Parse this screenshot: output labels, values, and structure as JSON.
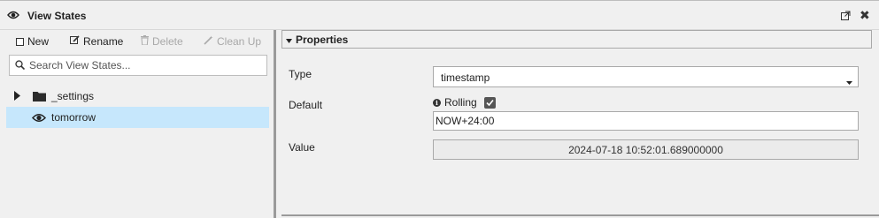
{
  "window": {
    "title": "View States"
  },
  "toolbar": {
    "new_label": "New",
    "rename_label": "Rename",
    "delete_label": "Delete",
    "cleanup_label": "Clean Up"
  },
  "search": {
    "placeholder": "Search View States..."
  },
  "tree": {
    "items": [
      {
        "label": "_settings",
        "type": "folder",
        "selected": false
      },
      {
        "label": "tomorrow",
        "type": "view-state",
        "selected": true
      }
    ]
  },
  "properties": {
    "section_title": "Properties",
    "type_label": "Type",
    "type_value": "timestamp",
    "default_label": "Default",
    "rolling_label": "Rolling",
    "rolling_checked": true,
    "default_value": "NOW+24:00",
    "value_label": "Value",
    "value_value": "2024-07-18 10:52:01.689000000"
  },
  "colors": {
    "selection": "#c6e7fc",
    "background": "#f0f0f0",
    "splitter": "#9a9a9a"
  }
}
